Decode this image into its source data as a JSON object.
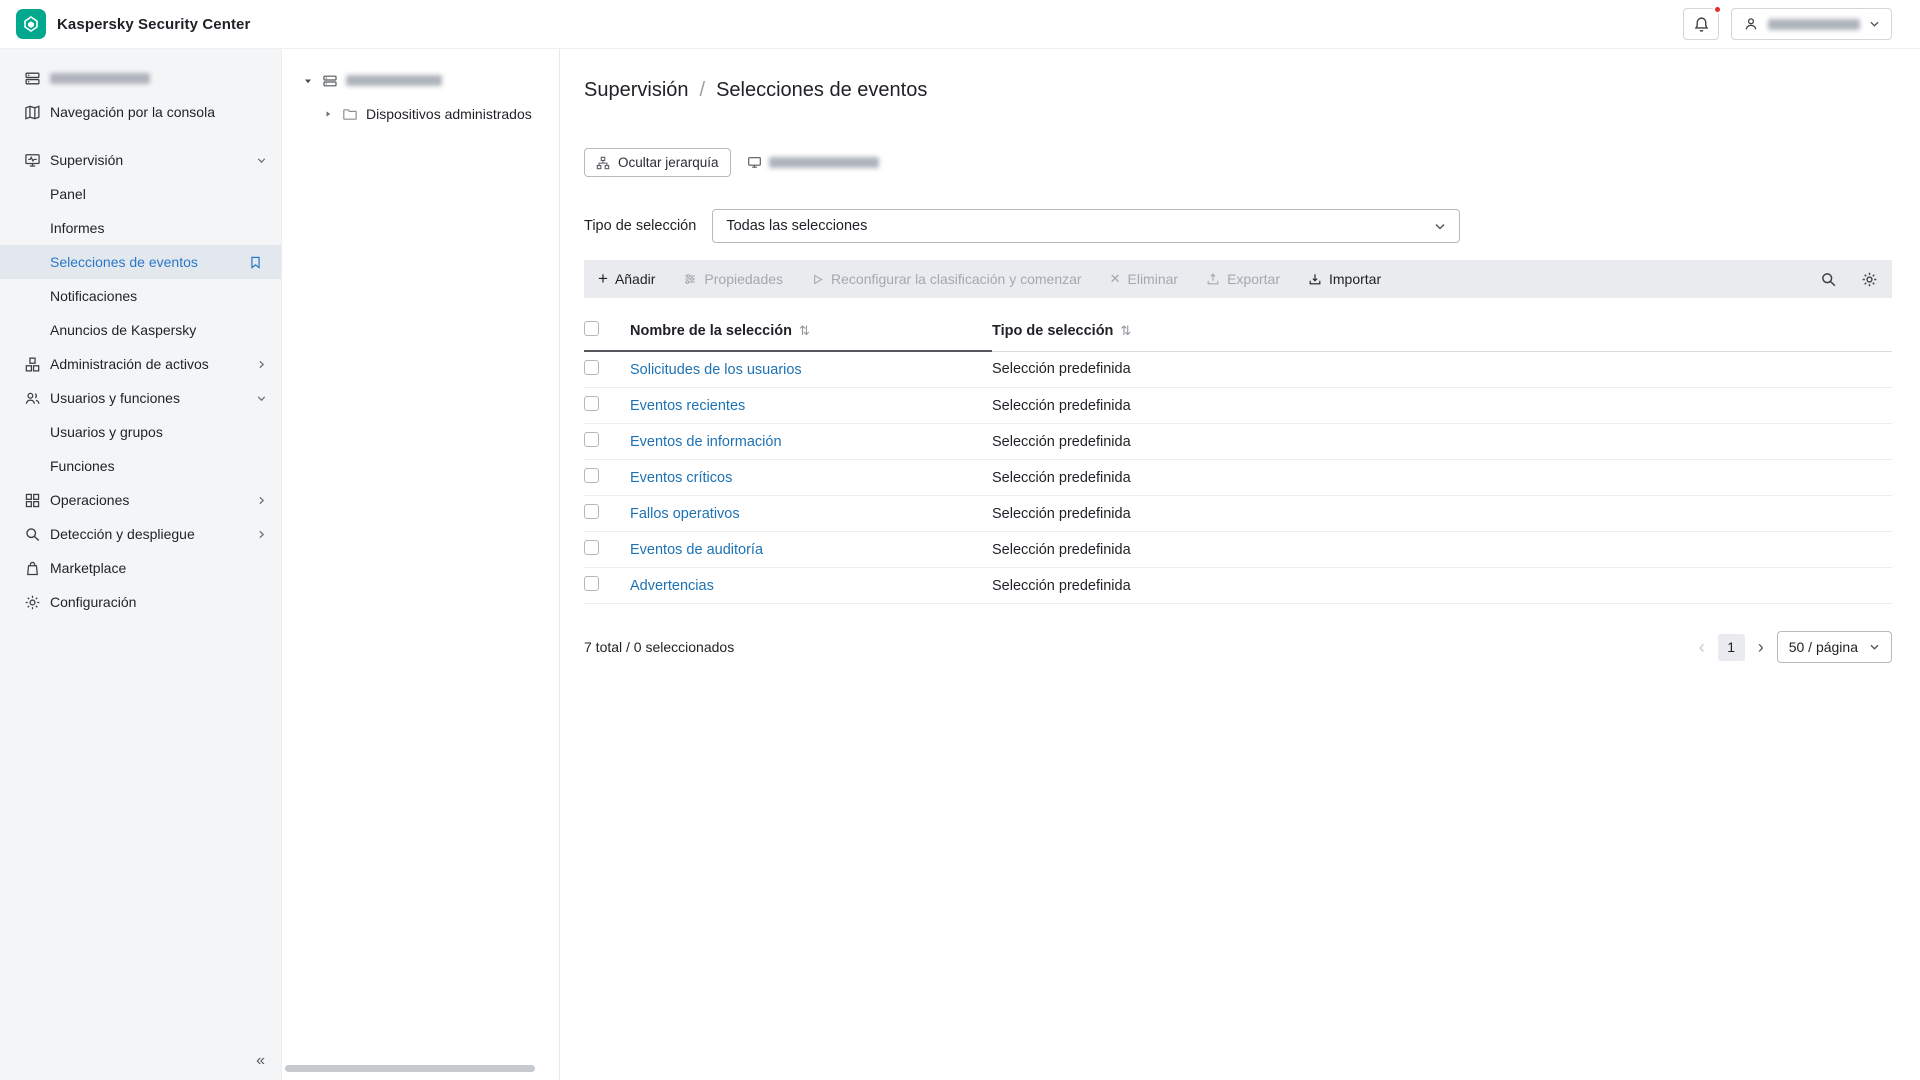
{
  "colors": {
    "brand_green": "#00a88e",
    "link_blue": "#1d72b5",
    "selected_sidebar_bg": "#e3e8ef",
    "toolbar_bg": "#e9ebee",
    "sidebar_bg": "#f4f5f7",
    "notification_red": "#e52b2b"
  },
  "icons": {
    "add": "+",
    "delete": "✕",
    "collapse": "«",
    "sort": "⇅",
    "prev": "‹",
    "next": "›"
  },
  "header": {
    "app_title": "Kaspersky Security Center"
  },
  "sidebar": {
    "items": [
      "",
      "Navegación por la consola",
      "Supervisión",
      "Panel",
      "Informes",
      "Selecciones de eventos",
      "Notificaciones",
      "Anuncios de Kaspersky",
      "Administración de activos",
      "Usuarios y funciones",
      "Usuarios y grupos",
      "Funciones",
      "Operaciones",
      "Detección y despliegue",
      "Marketplace",
      "Configuración"
    ]
  },
  "tree": {
    "managed_devices": "Dispositivos administrados"
  },
  "main": {
    "breadcrumb": {
      "section": "Supervisión",
      "separator": "/",
      "current": "Selecciones de eventos"
    },
    "hide_hierarchy_label": "Ocultar jerarquía",
    "filter": {
      "label": "Tipo de selección",
      "value": "Todas las selecciones"
    },
    "toolbar": {
      "add": "Añadir",
      "properties": "Propiedades",
      "reconfigure": "Reconfigurar la clasificación y comenzar",
      "delete": "Eliminar",
      "export": "Exportar",
      "import": "Importar"
    },
    "table": {
      "headers": [
        "Nombre de la selección",
        "Tipo de selección"
      ],
      "rows": [
        {
          "name": "Solicitudes de los usuarios",
          "type": "Selección predefinida"
        },
        {
          "name": "Eventos recientes",
          "type": "Selección predefinida"
        },
        {
          "name": "Eventos de información",
          "type": "Selección predefinida"
        },
        {
          "name": "Eventos críticos",
          "type": "Selección predefinida"
        },
        {
          "name": "Fallos operativos",
          "type": "Selección predefinida"
        },
        {
          "name": "Eventos de auditoría",
          "type": "Selección predefinida"
        },
        {
          "name": "Advertencias",
          "type": "Selección predefinida"
        }
      ]
    },
    "footer": {
      "total": "7 total / 0 seleccionados",
      "page_current": "1",
      "page_size": "50 / página"
    }
  }
}
